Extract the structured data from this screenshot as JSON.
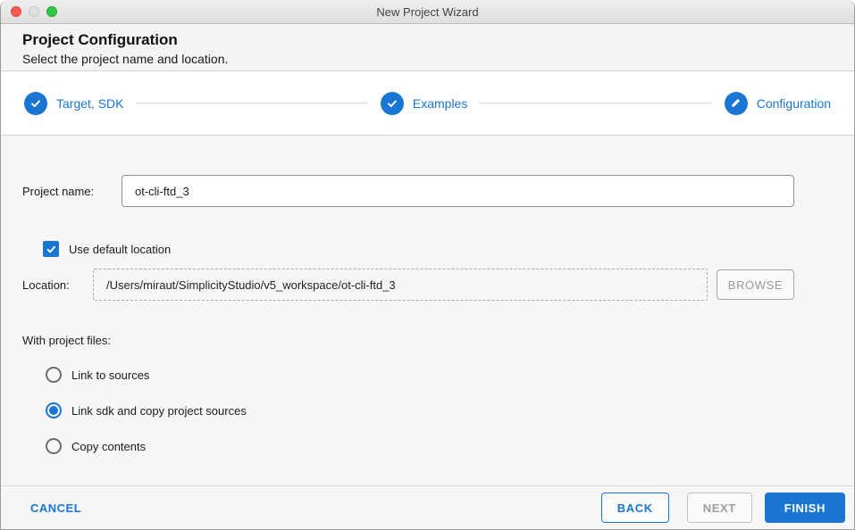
{
  "window": {
    "title": "New Project Wizard"
  },
  "header": {
    "title": "Project Configuration",
    "subtitle": "Select the project name and location."
  },
  "stepper": {
    "steps": [
      {
        "label": "Target, SDK",
        "icon": "check-icon",
        "state": "complete"
      },
      {
        "label": "Examples",
        "icon": "check-icon",
        "state": "complete"
      },
      {
        "label": "Configuration",
        "icon": "pencil-icon",
        "state": "current"
      }
    ]
  },
  "form": {
    "project_name": {
      "label": "Project name:",
      "value": "ot-cli-ftd_3"
    },
    "use_default_location": {
      "label": "Use default location",
      "checked": true
    },
    "location": {
      "label": "Location:",
      "value": "/Users/miraut/SimplicityStudio/v5_workspace/ot-cli-ftd_3",
      "disabled": true,
      "browse_label": "BROWSE",
      "browse_disabled": true
    },
    "with_project_files": {
      "label": "With project files:",
      "options": [
        {
          "label": "Link to sources",
          "selected": false
        },
        {
          "label": "Link sdk and copy project sources",
          "selected": true
        },
        {
          "label": "Copy contents",
          "selected": false
        }
      ]
    }
  },
  "footer": {
    "cancel_label": "CANCEL",
    "back_label": "BACK",
    "next_label": "NEXT",
    "next_disabled": true,
    "finish_label": "FINISH"
  },
  "colors": {
    "accent_blue": "#1976d2",
    "traffic_red": "#fc5753",
    "traffic_gray": "#e0e0e0",
    "traffic_green": "#33c748"
  }
}
